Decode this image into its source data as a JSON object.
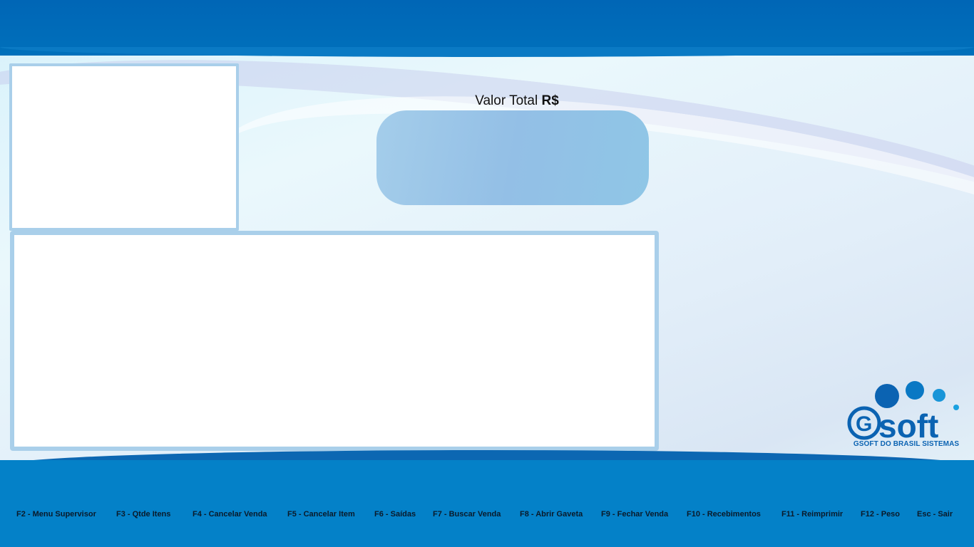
{
  "total": {
    "label": "Valor Total",
    "currency": "R$",
    "value": ""
  },
  "logo": {
    "brand": "Gsoft",
    "subtitle": "GSOFT DO BRASIL SISTEMAS"
  },
  "shortcuts": [
    "F2 - Menu Supervisor",
    "F3 - Qtde Itens",
    "F4 - Cancelar Venda",
    "F5 - Cancelar Item",
    "F6 - Saídas",
    "F7 - Buscar Venda",
    "F8 - Abrir Gaveta",
    "F9 - Fechar Venda",
    "F10 - Recebimentos",
    "F11 - Reimprimir",
    "F12 - Peso",
    "Esc - Sair"
  ],
  "colors": {
    "header": "#0068b7",
    "footer": "#0481c8",
    "panel_border": "#a9cfea",
    "total_box": "#93bfe6",
    "logo_blue": "#0b63b2"
  }
}
